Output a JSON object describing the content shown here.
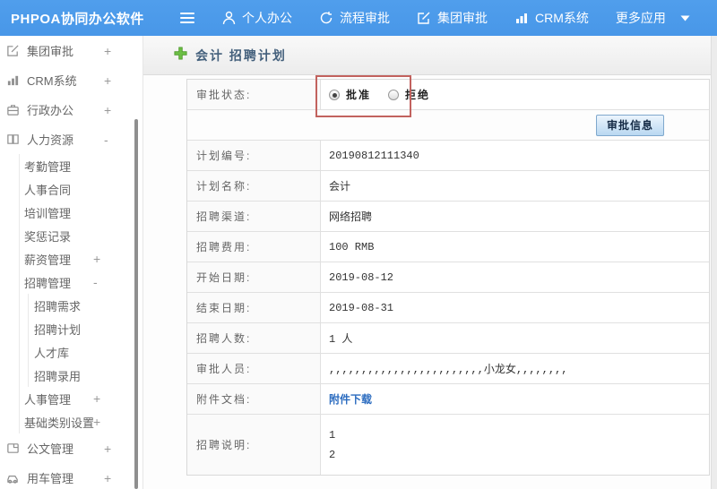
{
  "topbar": {
    "brand": "PHPOA协同办公软件",
    "items": [
      {
        "label": "个人办公",
        "icon": "user-icon"
      },
      {
        "label": "流程审批",
        "icon": "process-icon"
      },
      {
        "label": "集团审批",
        "icon": "edit-icon"
      },
      {
        "label": "CRM系统",
        "icon": "bar-chart-icon"
      },
      {
        "label": "更多应用",
        "icon": "caret-down-icon"
      }
    ]
  },
  "sidebar": {
    "items": [
      {
        "label": "集团审批",
        "icon": "edit-icon",
        "expand": "+"
      },
      {
        "label": "CRM系统",
        "icon": "bar-chart-icon",
        "expand": "+"
      },
      {
        "label": "行政办公",
        "icon": "briefcase-icon",
        "expand": "+"
      },
      {
        "label": "人力资源",
        "icon": "book-icon",
        "expand": "-"
      },
      {
        "label": "考勤管理"
      },
      {
        "label": "人事合同"
      },
      {
        "label": "培训管理"
      },
      {
        "label": "奖惩记录"
      },
      {
        "label": "薪资管理",
        "expand": "+"
      },
      {
        "label": "招聘管理",
        "expand": "-"
      },
      {
        "label": "招聘需求"
      },
      {
        "label": "招聘计划"
      },
      {
        "label": "人才库"
      },
      {
        "label": "招聘录用"
      },
      {
        "label": "人事管理",
        "expand": "+"
      },
      {
        "label": "基础类别设置",
        "expand": "+"
      },
      {
        "label": "公文管理",
        "icon": "document-icon",
        "expand": "+"
      },
      {
        "label": "用车管理",
        "icon": "car-icon",
        "expand": "+"
      }
    ]
  },
  "content": {
    "title": "会计 招聘计划",
    "approval": {
      "label": "审批状态:",
      "options": [
        {
          "label": "批准",
          "checked": true
        },
        {
          "label": "拒绝",
          "checked": false
        }
      ]
    },
    "button_label": "审批信息",
    "rows": [
      {
        "label": "计划编号:",
        "value": "20190812111340"
      },
      {
        "label": "计划名称:",
        "value": "会计"
      },
      {
        "label": "招聘渠道:",
        "value": "网络招聘"
      },
      {
        "label": "招聘费用:",
        "value": "100 RMB"
      },
      {
        "label": "开始日期:",
        "value": "2019-08-12"
      },
      {
        "label": "结束日期:",
        "value": "2019-08-31"
      },
      {
        "label": "招聘人数:",
        "value": "1 人"
      },
      {
        "label": "审批人员:",
        "value": ",,,,,,,,,,,,,,,,,,,,,,,,小龙女,,,,,,,,"
      },
      {
        "label": "附件文档:",
        "value": "附件下载"
      },
      {
        "label": "招聘说明:",
        "lines": [
          "1",
          "2"
        ]
      }
    ]
  },
  "colors": {
    "topbar_blue": "#4b9aea",
    "annotation_red": "#c2625e",
    "link_blue": "#2d6dc0",
    "button_face": "#b9d8f1",
    "table_border": "#e0e0e0"
  }
}
